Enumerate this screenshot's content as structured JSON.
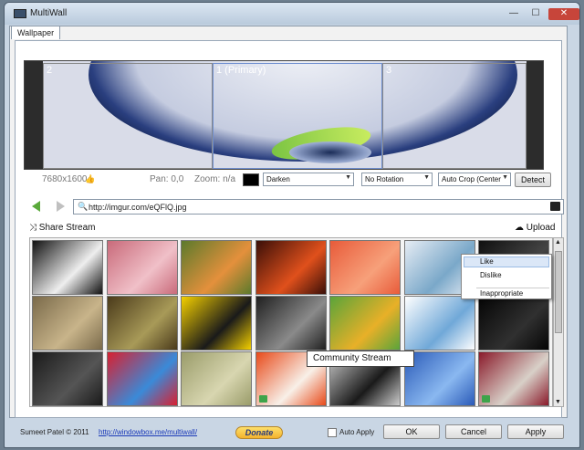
{
  "window": {
    "title": "MultiWall",
    "minimize": "—",
    "maximize": "☐",
    "close": "✕"
  },
  "tabs": [
    {
      "label": "Wallpaper"
    }
  ],
  "preview": {
    "monitors": [
      {
        "label": "2"
      },
      {
        "label": "1 (Primary)"
      },
      {
        "label": "3"
      }
    ],
    "resolution": "7680x1600",
    "pan": "Pan: 0,0",
    "zoom": "Zoom: n/a",
    "blend_mode": "Darken",
    "rotation": "No Rotation",
    "crop": "Auto Crop (Center",
    "detect_label": "Detect"
  },
  "navigation": {
    "url": "http://imgur.com/eQFlQ.jpg"
  },
  "stream": {
    "share_label": "Share Stream",
    "upload_label": "Upload"
  },
  "thumbnails": [
    {
      "name": "skull",
      "colors": [
        "#111111",
        "#eeeeee"
      ],
      "liked": false
    },
    {
      "name": "pink-lily",
      "colors": [
        "#c96a7a",
        "#f0c0c8"
      ],
      "liked": false
    },
    {
      "name": "orange-flower",
      "colors": [
        "#5c7a2c",
        "#e4903c"
      ],
      "liked": false
    },
    {
      "name": "red-flower",
      "colors": [
        "#3a0f08",
        "#e0501c"
      ],
      "liked": false
    },
    {
      "name": "coral-stripes",
      "colors": [
        "#e85b3a",
        "#f7a07a"
      ],
      "liked": false
    },
    {
      "name": "blue-bowl",
      "colors": [
        "#e6ecf4",
        "#7aa8c9"
      ],
      "liked": false
    },
    {
      "name": "dark-abstract",
      "colors": [
        "#101010",
        "#444444"
      ],
      "liked": false
    },
    {
      "name": "stone-building",
      "colors": [
        "#7a6a4a",
        "#c8b48a"
      ],
      "liked": false
    },
    {
      "name": "hedgehog",
      "colors": [
        "#4a3a1a",
        "#a89a58"
      ],
      "liked": false
    },
    {
      "name": "yellow-tree",
      "colors": [
        "#f4d000",
        "#1a1a1a"
      ],
      "liked": false
    },
    {
      "name": "dark-creature",
      "colors": [
        "#202020",
        "#8a8a8a"
      ],
      "liked": false
    },
    {
      "name": "green-yellow-mix",
      "colors": [
        "#5aa43a",
        "#e8b028"
      ],
      "liked": false
    },
    {
      "name": "blue-arrow",
      "colors": [
        "#ffffff",
        "#70a8d8"
      ],
      "liked": false
    },
    {
      "name": "black-panel",
      "colors": [
        "#050505",
        "#303030"
      ],
      "liked": false
    },
    {
      "name": "keyboard",
      "colors": [
        "#1a1a1a",
        "#555555"
      ],
      "liked": false
    },
    {
      "name": "red-blue-swirl",
      "colors": [
        "#d82030",
        "#3a8ad8"
      ],
      "liked": false
    },
    {
      "name": "circuit-map",
      "colors": [
        "#9a9c6a",
        "#d8d6b0"
      ],
      "liked": false
    },
    {
      "name": "orange-bottle",
      "colors": [
        "#e84a1a",
        "#f8f0e8"
      ],
      "liked": true
    },
    {
      "name": "black-white-bars",
      "colors": [
        "#cccccc",
        "#1a1a1a"
      ],
      "liked": false
    },
    {
      "name": "blue-sky-pole",
      "colors": [
        "#2a5ab8",
        "#8ab8f0"
      ],
      "liked": false
    },
    {
      "name": "red-fern",
      "colors": [
        "#8a1a2a",
        "#d8d0c8"
      ],
      "liked": true
    }
  ],
  "context_menu": {
    "items": [
      "Like",
      "Dislike",
      "Inappropriate"
    ]
  },
  "tooltip": "Community Stream",
  "footer": {
    "copyright": "Sumeet Patel © 2011",
    "link": "http://windowbox.me/multiwall/",
    "donate": "Donate",
    "auto_apply": "Auto Apply",
    "ok": "OK",
    "cancel": "Cancel",
    "apply": "Apply"
  },
  "colors": {
    "accent": "#6f8fd0",
    "like_green": "#3ea44a",
    "chrome": "#c9d6e4"
  }
}
